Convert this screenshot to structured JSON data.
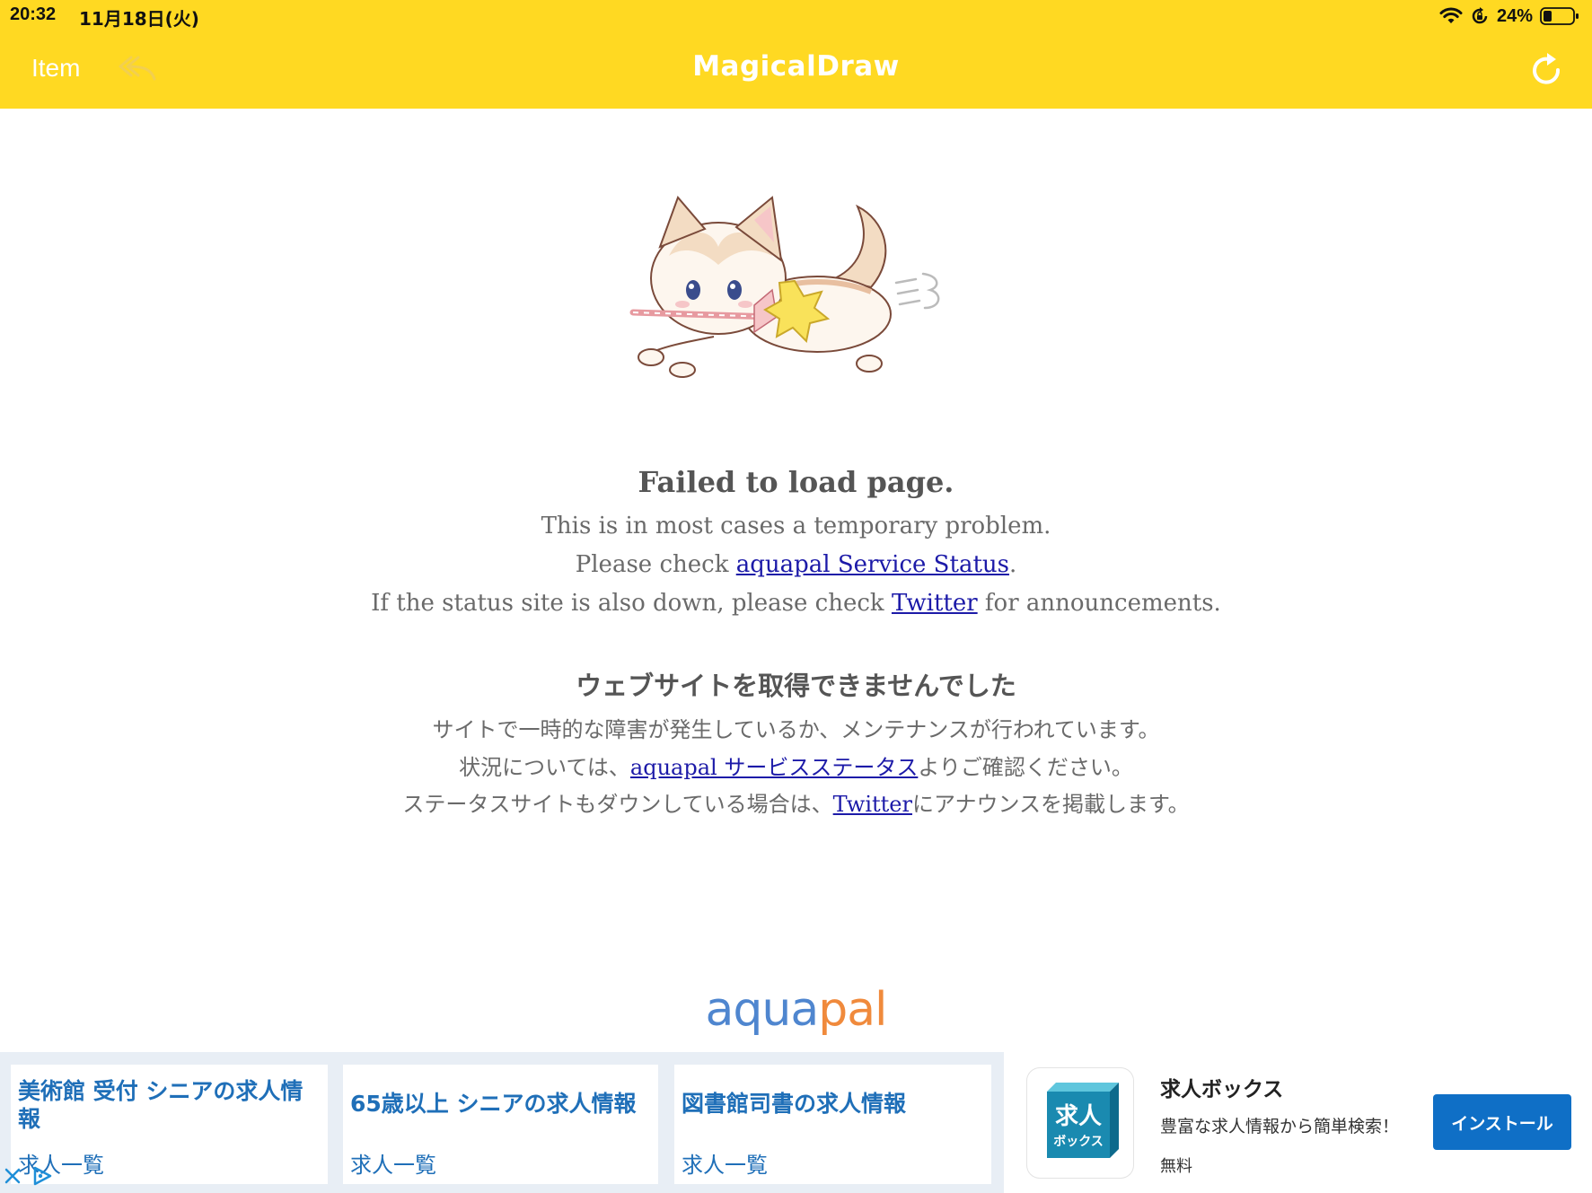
{
  "status_bar": {
    "time": "20:32",
    "date": "11月18日(火)",
    "battery_percent": "24%",
    "battery_level": 0.24,
    "icons": [
      "wifi-icon",
      "orientation-lock-icon",
      "battery-icon"
    ]
  },
  "nav": {
    "left_label": "Item",
    "title": "MagicalDraw",
    "icons": [
      "back-arrow-icon",
      "reload-icon"
    ],
    "colors": {
      "bar": "#ffd922",
      "text": "#ffffff"
    }
  },
  "error": {
    "en": {
      "title": "Failed to load page.",
      "line1": "This is in most cases a temporary problem.",
      "line2_prefix": "Please check ",
      "line2_link": "aquapal Service Status",
      "line2_suffix": ".",
      "line3_prefix": "If the status site is also down, please check ",
      "line3_link": "Twitter",
      "line3_suffix": " for announcements."
    },
    "jp": {
      "title": "ウェブサイトを取得できませんでした",
      "line1": "サイトで一時的な障害が発生しているか、メンテナンスが行われています。",
      "line2_prefix": "状況については、",
      "line2_link": "aquapal サービスステータス",
      "line2_suffix": "よりご確認ください。",
      "line3_prefix": "ステータスサイトもダウンしている場合は、",
      "line3_link": "Twitter",
      "line3_suffix": "にアナウンスを掲載します。"
    },
    "illustration": "flying-cat-with-magic-wand"
  },
  "footer_logo": {
    "part1": "aqua",
    "part2": "pal"
  },
  "ad": {
    "cards": [
      {
        "title": "美術館 受付 シニアの求人情報",
        "sub": "求人一覧"
      },
      {
        "title": "65歳以上 シニアの求人情報",
        "sub": "求人一覧"
      },
      {
        "title": "図書館司書の求人情報",
        "sub": "求人一覧"
      }
    ],
    "app": {
      "icon_text_top": "求人",
      "icon_text_bottom": "ボックス",
      "name": "求人ボックス",
      "description": "豊富な求人情報から簡単検索！",
      "price": "無料",
      "install_label": "インストール"
    },
    "colors": {
      "link": "#1f6fb8",
      "button": "#0f6fc6"
    }
  }
}
